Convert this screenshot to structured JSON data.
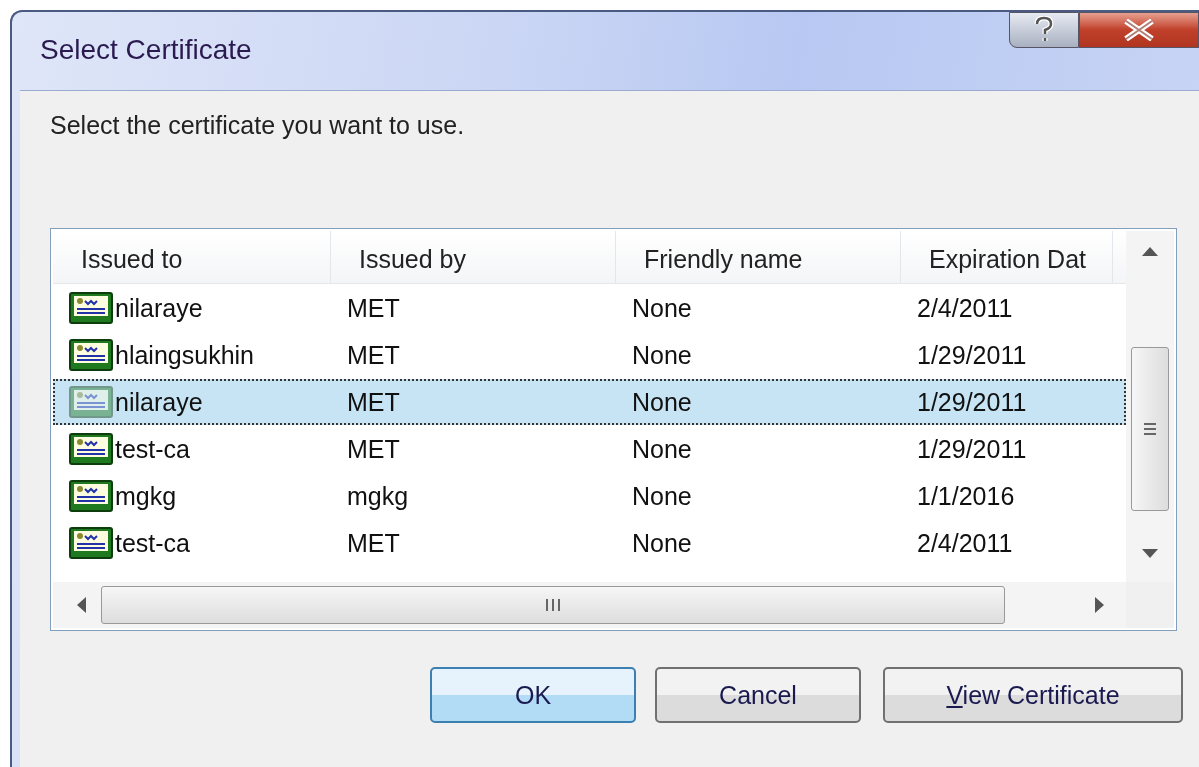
{
  "window": {
    "title": "Select Certificate"
  },
  "prompt": "Select the certificate you want to use.",
  "table": {
    "columns": [
      "Issued to",
      "Issued by",
      "Friendly name",
      "Expiration Dat"
    ],
    "rows": [
      {
        "cells": [
          "nilaraye",
          "MET",
          "None",
          "2/4/2011"
        ],
        "selected": false
      },
      {
        "cells": [
          "hlaingsukhin",
          "MET",
          "None",
          "1/29/2011"
        ],
        "selected": false
      },
      {
        "cells": [
          "nilaraye",
          "MET",
          "None",
          "1/29/2011"
        ],
        "selected": true
      },
      {
        "cells": [
          "test-ca",
          "MET",
          "None",
          "1/29/2011"
        ],
        "selected": false
      },
      {
        "cells": [
          "mgkg",
          "mgkg",
          "None",
          "1/1/2016"
        ],
        "selected": false
      },
      {
        "cells": [
          "test-ca",
          "MET",
          "None",
          "2/4/2011"
        ],
        "selected": false
      }
    ]
  },
  "buttons": [
    {
      "label": "OK",
      "default": true,
      "mnemonic": false
    },
    {
      "label": "Cancel",
      "default": false,
      "mnemonic": false
    },
    {
      "label": "View Certificate",
      "default": false,
      "mnemonic": true
    }
  ]
}
